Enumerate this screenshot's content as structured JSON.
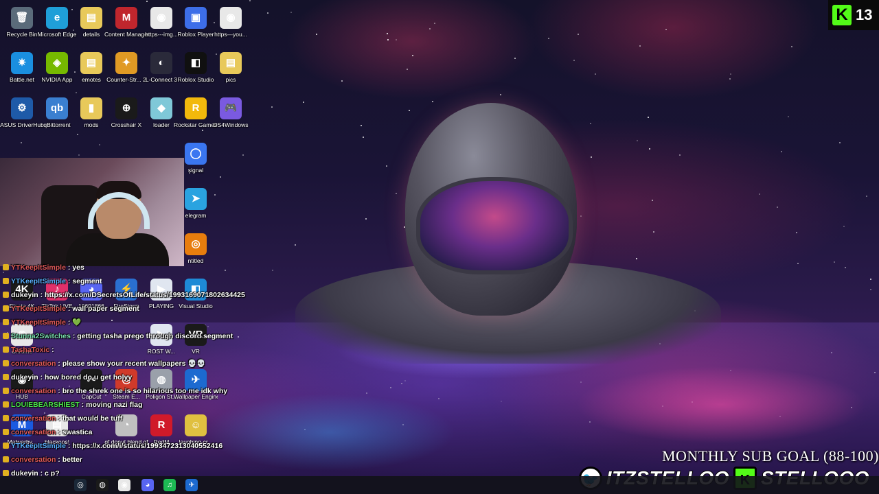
{
  "desktop_icons": [
    {
      "label": "Recycle Bin",
      "icon": "recycle-bin-icon",
      "glyph": "🗑",
      "color": "#5a6b7a"
    },
    {
      "label": "Microsoft Edge",
      "icon": "edge-icon",
      "glyph": "e",
      "color": "#1f9fd8"
    },
    {
      "label": "details",
      "icon": "file-icon",
      "glyph": "▤",
      "color": "#e8c95a"
    },
    {
      "label": "Content Manager",
      "icon": "content-manager-icon",
      "glyph": "M",
      "color": "#c0262d"
    },
    {
      "label": "https---img...",
      "icon": "chrome-icon",
      "glyph": "◉",
      "color": "#e8e8e8"
    },
    {
      "label": "Roblox Player",
      "icon": "roblox-icon",
      "glyph": "▣",
      "color": "#3d6ee8"
    },
    {
      "label": "https---you...",
      "icon": "chrome-icon",
      "glyph": "◉",
      "color": "#e8e8e8"
    },
    {
      "label": "Battle.net",
      "icon": "battlenet-icon",
      "glyph": "✷",
      "color": "#1a8fe0"
    },
    {
      "label": "NVIDIA App",
      "icon": "nvidia-icon",
      "glyph": "◈",
      "color": "#76b900"
    },
    {
      "label": "emotes",
      "icon": "folder-icon",
      "glyph": "▤",
      "color": "#e8c95a"
    },
    {
      "label": "Counter-Str... 2",
      "icon": "counter-strike-icon",
      "glyph": "✦",
      "color": "#e09a24"
    },
    {
      "label": "L-Connect 3",
      "icon": "lconnect-icon",
      "glyph": "◐",
      "color": "#2a2a3a"
    },
    {
      "label": "Roblox Studio",
      "icon": "roblox-studio-icon",
      "glyph": "◧",
      "color": "#101010"
    },
    {
      "label": "pics",
      "icon": "folder-icon",
      "glyph": "▤",
      "color": "#e8c95a"
    },
    {
      "label": "ASUS DriverHub",
      "icon": "asus-icon",
      "glyph": "⚙",
      "color": "#1e5aa8"
    },
    {
      "label": "qBittorrent",
      "icon": "qbittorrent-icon",
      "glyph": "qb",
      "color": "#3a7fd0"
    },
    {
      "label": "mods",
      "icon": "folder-icon",
      "glyph": "▮",
      "color": "#e8c95a"
    },
    {
      "label": "Crosshair X",
      "icon": "crosshair-icon",
      "glyph": "⊕",
      "color": "#1a1a1a"
    },
    {
      "label": "loader",
      "icon": "loader-icon",
      "glyph": "◆",
      "color": "#7fc8d8"
    },
    {
      "label": "Rockstar Games ...",
      "icon": "rockstar-icon",
      "glyph": "R",
      "color": "#f2b90c"
    },
    {
      "label": "DS4Windows",
      "icon": "gamepad-icon",
      "glyph": "🎮",
      "color": "#7a5ae0"
    },
    {
      "label": "signal",
      "icon": "signal-icon",
      "glyph": "◯",
      "color": "#3a76f0"
    },
    {
      "label": "elegram",
      "icon": "telegram-icon",
      "glyph": "➤",
      "color": "#2aa3e0"
    },
    {
      "label": "ntitled",
      "icon": "blender-icon",
      "glyph": "◎",
      "color": "#e87d0d"
    },
    {
      "label": "Elgato 4K",
      "icon": "elgato-icon",
      "glyph": "4K",
      "color": "#1a1a1a"
    },
    {
      "label": "TikTok LIVE",
      "icon": "tiktok-icon",
      "glyph": "♪",
      "color": "#e0306a"
    },
    {
      "label": "10691866",
      "icon": "discord-icon",
      "glyph": "◕",
      "color": "#5865f2"
    },
    {
      "label": "FireStorm",
      "icon": "firestorm-icon",
      "glyph": "⚡",
      "color": "#2a6fd0"
    },
    {
      "label": "PLAYING",
      "icon": "file-icon",
      "glyph": "▶",
      "color": "#e0e6f0"
    },
    {
      "label": "Visual Studio",
      "icon": "vscode-icon",
      "glyph": "◧",
      "color": "#1e8ad6"
    },
    {
      "label": "Chrome",
      "icon": "chrome-icon",
      "glyph": "◉",
      "color": "#e8e8e8"
    },
    {
      "label": "CapCut",
      "icon": "capcut-icon",
      "glyph": "✂",
      "color": "#1a1a1a"
    },
    {
      "label": "Steam E...",
      "icon": "steam-icon",
      "glyph": "◎",
      "color": "#d03a2a"
    },
    {
      "label": "Poligon St...",
      "icon": "poligon-icon",
      "glyph": "◍",
      "color": "#9aa0aa"
    },
    {
      "label": "Wallpaper Engine",
      "icon": "wallpaper-engine-icon",
      "glyph": "✈",
      "color": "#1c6ad0"
    },
    {
      "label": "HUB",
      "icon": "hub-icon",
      "glyph": "◉",
      "color": "#1a1a1a"
    },
    {
      "label": "Malwarby...",
      "icon": "malwarebytes-icon",
      "glyph": "M",
      "color": "#1a5ae0"
    },
    {
      "label": "blackops!",
      "icon": "file-icon",
      "glyph": "▤",
      "color": "#e8e8e8"
    },
    {
      "label": "gf donut blend.gf",
      "icon": "file-icon",
      "glyph": "◔",
      "color": "#c0c0c0"
    },
    {
      "label": "RedM",
      "icon": "redm-icon",
      "glyph": "R",
      "color": "#d01a2a"
    },
    {
      "label": "laughing-cr...",
      "icon": "image-icon",
      "glyph": "☺",
      "color": "#e0c040"
    },
    {
      "label": "VR",
      "icon": "vr-icon",
      "glyph": "VR",
      "color": "#1a1a1a"
    },
    {
      "label": "ROST W...",
      "icon": "file-icon",
      "glyph": "▶",
      "color": "#e0e6f0"
    }
  ],
  "chat": [
    {
      "user": "YTKeepItSimple",
      "color": "#e05a5a",
      "message": "yes"
    },
    {
      "user": "YTKeepItSimple",
      "color": "#5ab0ff",
      "message": "segment"
    },
    {
      "user": "dukeyin",
      "color": "#ffffff",
      "message": "https://x.com/DSecretsOfLife/status/1993169071802634425"
    },
    {
      "user": "YTKeepItSimple",
      "color": "#e05a5a",
      "message": "wall paper segment"
    },
    {
      "user": "YTKeepItSimple",
      "color": "#e05a5a",
      "message": "💚"
    },
    {
      "user": "Stunna2Switches",
      "color": "#7ae0b0",
      "message": "getting tasha prego through discord segment"
    },
    {
      "user": "TashaToxic",
      "color": "#e05a5a",
      "message": ""
    },
    {
      "user": "conversation",
      "color": "#e05a5a",
      "message": "please show your recent wallpapers 💀💀"
    },
    {
      "user": "dukeyin",
      "color": "#ffffff",
      "message": "how bored do u get holyy"
    },
    {
      "user": "conversation",
      "color": "#e05a5a",
      "message": "bro the shrek one is so hilarious too me idk why"
    },
    {
      "user": "LOUIEBEARSHIEST",
      "color": "#4ae04a",
      "message": "moving nazi flag"
    },
    {
      "user": "conversation",
      "color": "#e05a5a",
      "message": "that would be tuff"
    },
    {
      "user": "conversation",
      "color": "#e05a5a",
      "message": "swastica"
    },
    {
      "user": "YTKeepItSimple",
      "color": "#5ab0ff",
      "message": "https://x.com/i/status/1993472313040552416"
    },
    {
      "user": "conversation",
      "color": "#e05a5a",
      "message": "better"
    },
    {
      "user": "dukeyin",
      "color": "#ffffff",
      "message": "c p?"
    }
  ],
  "overlay": {
    "kick_count": "13",
    "kick_logo": "K",
    "sub_goal": "MONTHLY SUB GOAL (88-100)",
    "twitter_handle": "ITZSTELLOO",
    "kick_handle": "STELLOOO",
    "twitter_glyph": "🐦",
    "kick_glyph": "K"
  },
  "taskbar": {
    "icons": [
      {
        "name": "steam-icon",
        "glyph": "◎",
        "color": "#1b2838"
      },
      {
        "name": "malwarebytes-icon",
        "glyph": "◍",
        "color": "#1a1a1a"
      },
      {
        "name": "chrome-icon",
        "glyph": "◉",
        "color": "#e8e8e8"
      },
      {
        "name": "discord-icon",
        "glyph": "◕",
        "color": "#5865f2"
      },
      {
        "name": "spotify-icon",
        "glyph": "♫",
        "color": "#1db954"
      },
      {
        "name": "wallpaper-engine-icon",
        "glyph": "✈",
        "color": "#1c6ad0"
      }
    ]
  }
}
